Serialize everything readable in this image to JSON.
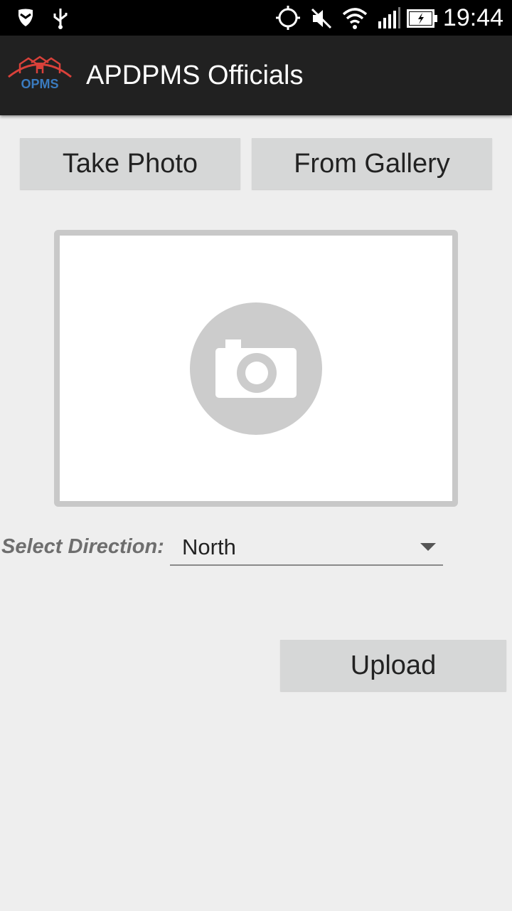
{
  "status_bar": {
    "time": "19:44",
    "icons": [
      "shield-icon",
      "usb-icon",
      "gps-icon",
      "mute-icon",
      "wifi-icon",
      "signal-icon",
      "battery-charging-icon"
    ]
  },
  "app_bar": {
    "title": "APDPMS Officials",
    "logo_text": "OPMS"
  },
  "buttons": {
    "take_photo": "Take Photo",
    "from_gallery": "From Gallery",
    "upload": "Upload"
  },
  "image_preview": {
    "placeholder_icon": "camera-icon"
  },
  "direction": {
    "label": "Select Direction:",
    "selected": "North"
  }
}
